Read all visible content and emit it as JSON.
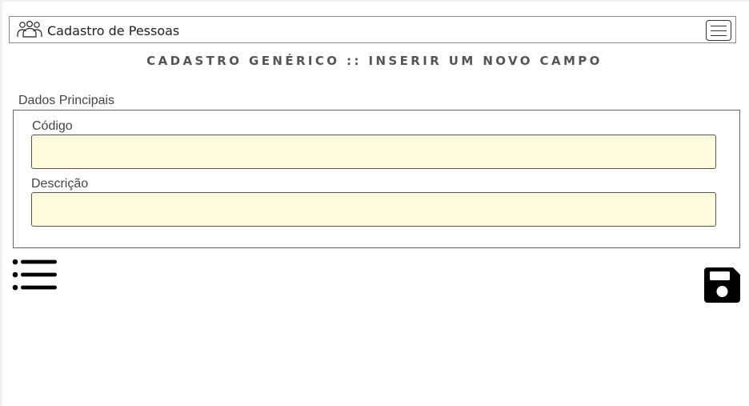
{
  "navbar": {
    "brand_icon": "users-icon",
    "brand_text": "Cadastro de Pessoas",
    "menu_icon": "hamburger-menu-icon"
  },
  "page": {
    "title": "CADASTRO GENÉRICO :: INSERIR UM NOVO CAMPO"
  },
  "form": {
    "section_legend": "Dados Principais",
    "fields": [
      {
        "label": "Código",
        "value": "",
        "placeholder": ""
      },
      {
        "label": "Descrição",
        "value": "",
        "placeholder": ""
      }
    ],
    "input_background": "#fffbdc"
  },
  "actions": {
    "list_icon": "list-icon",
    "save_icon": "floppy-disk-icon"
  }
}
